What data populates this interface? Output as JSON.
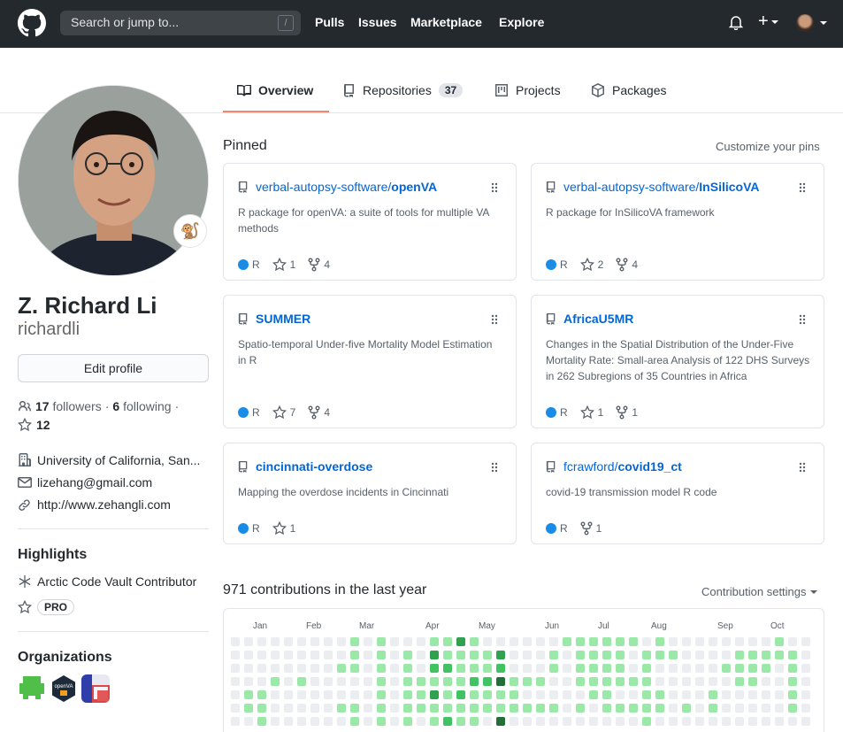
{
  "header": {
    "search_placeholder": "Search or jump to...",
    "slash_key": "/",
    "nav": [
      "Pulls",
      "Issues",
      "Marketplace",
      "Explore"
    ]
  },
  "tabs": [
    {
      "label": "Overview",
      "icon": "book-icon",
      "selected": true
    },
    {
      "label": "Repositories",
      "icon": "repo-icon",
      "count": "37"
    },
    {
      "label": "Projects",
      "icon": "project-icon"
    },
    {
      "label": "Packages",
      "icon": "package-icon"
    }
  ],
  "profile": {
    "status_emoji": "🐒",
    "fullname": "Z. Richard Li",
    "username": "richardli",
    "edit_label": "Edit profile",
    "followers_count": "17",
    "followers_label": "followers",
    "following_count": "6",
    "following_label": "following",
    "stars": "12",
    "org": "University of California, San...",
    "email": "lizehang@gmail.com",
    "website": "http://www.zehangli.com"
  },
  "highlights": {
    "title": "Highlights",
    "vault": "Arctic Code Vault Contributor",
    "pro": "PRO"
  },
  "organizations": {
    "title": "Organizations",
    "logos": [
      "green-pixel-org",
      "openva-org",
      "blue-red-org"
    ],
    "openva_text": "openVA"
  },
  "pinned": {
    "title": "Pinned",
    "customize": "Customize your pins",
    "cards": [
      {
        "owner": "verbal-autopsy-software/",
        "repo": "openVA",
        "desc": "R package for openVA: a suite of tools for multiple VA methods",
        "lang": "R",
        "stars": "1",
        "forks": "4"
      },
      {
        "owner": "verbal-autopsy-software/",
        "repo": "InSilicoVA",
        "desc": "R package for InSilicoVA framework",
        "lang": "R",
        "stars": "2",
        "forks": "4"
      },
      {
        "owner": "",
        "repo": "SUMMER",
        "desc": "Spatio-temporal Under-five Mortality Model Estimation in R",
        "lang": "R",
        "stars": "7",
        "forks": "4"
      },
      {
        "owner": "",
        "repo": "AfricaU5MR",
        "desc": "Changes in the Spatial Distribution of the Under-Five Mortality Rate: Small-area Analysis of 122 DHS Surveys in 262 Subregions of 35 Countries in Africa",
        "lang": "R",
        "stars": "1",
        "forks": "1"
      },
      {
        "owner": "",
        "repo": "cincinnati-overdose",
        "desc": "Mapping the overdose incidents in Cincinnati",
        "lang": "R",
        "stars": "1",
        "forks": ""
      },
      {
        "owner": "fcrawford/",
        "repo": "covid19_ct",
        "desc": "covid-19 transmission model R code",
        "lang": "R",
        "stars": "",
        "forks": "1"
      }
    ]
  },
  "contributions": {
    "title": "971 contributions in the last year",
    "settings": "Contribution settings",
    "months": [
      "Jan",
      "Feb",
      "Mar",
      "Apr",
      "May",
      "Jun",
      "Jul",
      "Aug",
      "Sep",
      "Oct"
    ],
    "levels_legend": [
      "#ebedf0",
      "#9be9a8",
      "#40c463",
      "#30a14e",
      "#216e39"
    ],
    "weeks": [
      [
        0,
        0,
        0,
        0,
        0,
        0,
        0
      ],
      [
        0,
        0,
        0,
        0,
        1,
        1,
        0
      ],
      [
        0,
        0,
        0,
        0,
        1,
        1,
        1
      ],
      [
        0,
        0,
        0,
        1,
        0,
        0,
        0
      ],
      [
        0,
        0,
        0,
        0,
        0,
        0,
        0
      ],
      [
        0,
        0,
        0,
        1,
        0,
        0,
        0
      ],
      [
        0,
        0,
        0,
        0,
        0,
        0,
        0
      ],
      [
        0,
        0,
        0,
        0,
        0,
        0,
        0
      ],
      [
        0,
        0,
        1,
        0,
        0,
        1,
        0
      ],
      [
        1,
        1,
        1,
        0,
        0,
        1,
        1
      ],
      [
        0,
        0,
        0,
        0,
        0,
        0,
        0
      ],
      [
        1,
        1,
        1,
        1,
        1,
        1,
        1
      ],
      [
        0,
        0,
        0,
        0,
        0,
        0,
        0
      ],
      [
        0,
        1,
        1,
        1,
        1,
        1,
        1
      ],
      [
        0,
        0,
        0,
        1,
        1,
        1,
        0
      ],
      [
        1,
        3,
        2,
        1,
        3,
        1,
        1
      ],
      [
        1,
        1,
        2,
        1,
        1,
        1,
        2
      ],
      [
        3,
        1,
        1,
        1,
        2,
        1,
        1
      ],
      [
        1,
        1,
        1,
        2,
        1,
        1,
        1
      ],
      [
        0,
        1,
        1,
        2,
        1,
        1,
        0
      ],
      [
        0,
        3,
        2,
        4,
        1,
        1,
        4
      ],
      [
        0,
        0,
        0,
        1,
        1,
        1,
        0
      ],
      [
        0,
        0,
        0,
        1,
        0,
        1,
        0
      ],
      [
        0,
        0,
        0,
        1,
        0,
        1,
        0
      ],
      [
        0,
        1,
        1,
        0,
        0,
        1,
        0
      ],
      [
        1,
        0,
        0,
        0,
        0,
        0,
        0
      ],
      [
        1,
        1,
        1,
        1,
        0,
        1,
        0
      ],
      [
        1,
        1,
        1,
        1,
        1,
        0,
        0
      ],
      [
        1,
        1,
        1,
        1,
        1,
        1,
        0
      ],
      [
        1,
        1,
        1,
        1,
        0,
        1,
        0
      ],
      [
        1,
        0,
        0,
        1,
        0,
        1,
        0
      ],
      [
        0,
        1,
        1,
        1,
        1,
        1,
        1
      ],
      [
        1,
        1,
        0,
        0,
        1,
        1,
        0
      ],
      [
        0,
        1,
        0,
        0,
        0,
        0,
        0
      ],
      [
        0,
        0,
        0,
        0,
        0,
        1,
        0
      ],
      [
        0,
        0,
        0,
        0,
        0,
        0,
        0
      ],
      [
        0,
        0,
        0,
        0,
        1,
        1,
        0
      ],
      [
        0,
        0,
        1,
        0,
        0,
        0,
        0
      ],
      [
        0,
        1,
        1,
        1,
        0,
        0,
        0
      ],
      [
        0,
        1,
        1,
        1,
        0,
        0,
        0
      ],
      [
        0,
        1,
        1,
        0,
        0,
        0,
        0
      ],
      [
        1,
        1,
        0,
        0,
        0,
        0,
        0
      ],
      [
        0,
        1,
        1,
        1,
        1,
        1,
        0
      ],
      [
        0,
        0,
        0,
        0,
        0,
        0,
        0
      ]
    ]
  },
  "colors": {
    "header_bg": "#24292e",
    "link": "#0366d6",
    "tab_accent": "#f9826c",
    "lang_r": "#198ce7"
  }
}
